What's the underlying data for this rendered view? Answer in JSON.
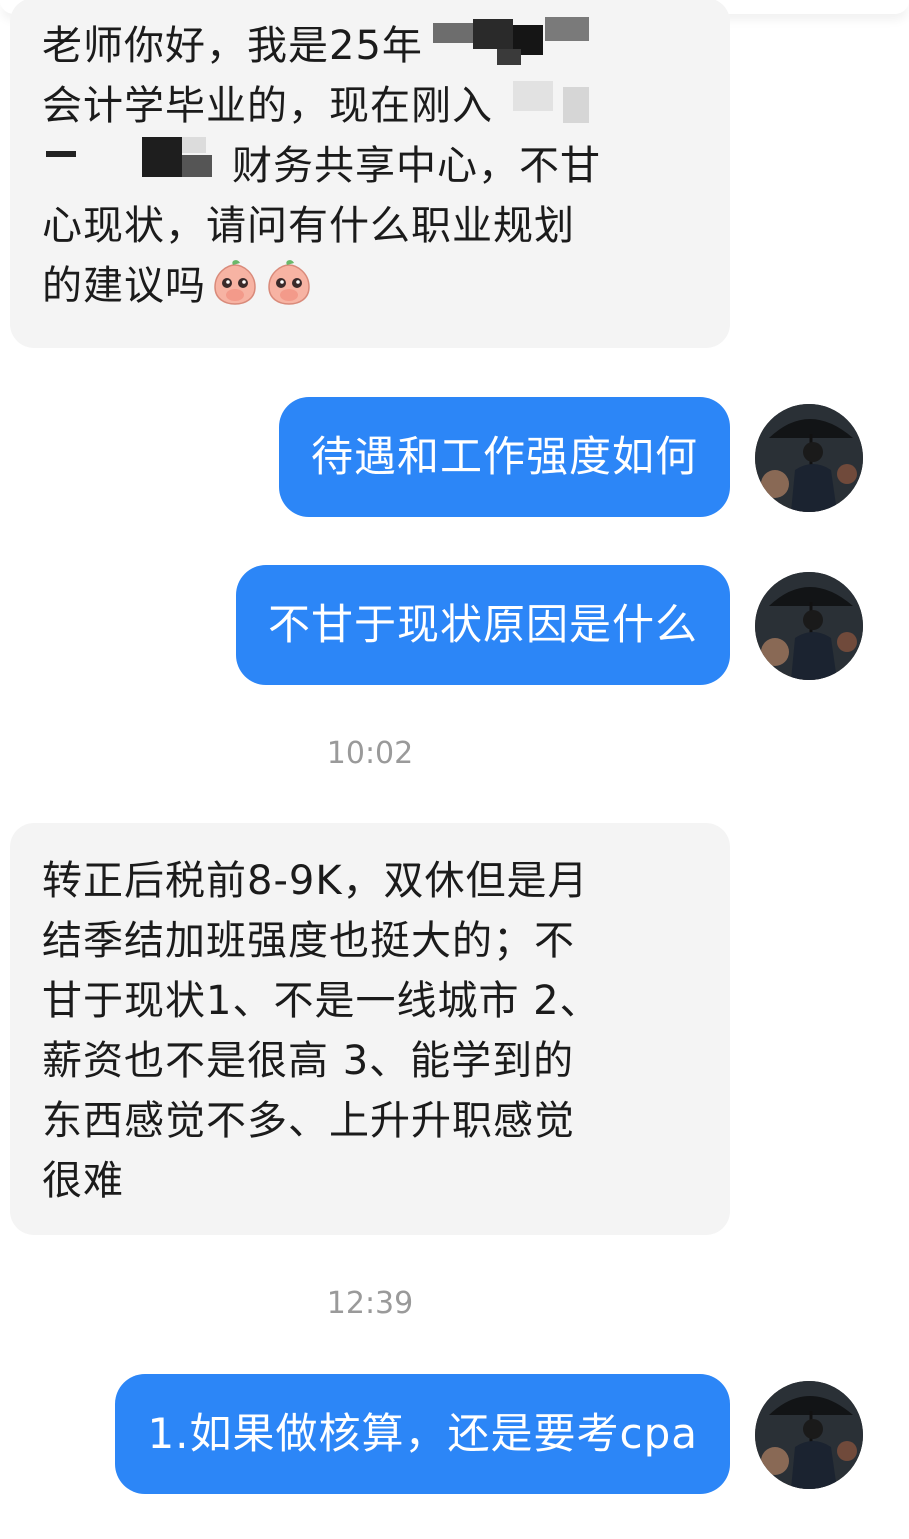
{
  "messages": [
    {
      "side": "left",
      "lines": [
        "老师你好，我是25年",
        "会计学毕业的，现在刚入",
        "财务共享中心，不甘",
        "心现状，请问有什么职业规划",
        "的建议吗"
      ],
      "emojis": [
        "peach-emoji",
        "peach-emoji"
      ]
    },
    {
      "side": "right",
      "text": "待遇和工作强度如何"
    },
    {
      "side": "right",
      "text": "不甘于现状原因是什么"
    },
    {
      "side": "left",
      "lines": [
        "转正后税前8-9K，双休但是月",
        "结季结加班强度也挺大的；不",
        "甘于现状1、不是一线城市 2、",
        "薪资也不是很高 3、能学到的",
        "东西感觉不多、上升升职感觉",
        "很难"
      ]
    },
    {
      "side": "right",
      "text": "1.如果做核算，还是要考cpa"
    }
  ],
  "timestamps": [
    "10:02",
    "12:39"
  ],
  "colors": {
    "outgoing_bubble": "#2c86f7",
    "incoming_bubble": "#f4f4f4",
    "timestamp_text": "#9a9a9a"
  },
  "avatar_icon": "man-with-umbrella-avatar"
}
